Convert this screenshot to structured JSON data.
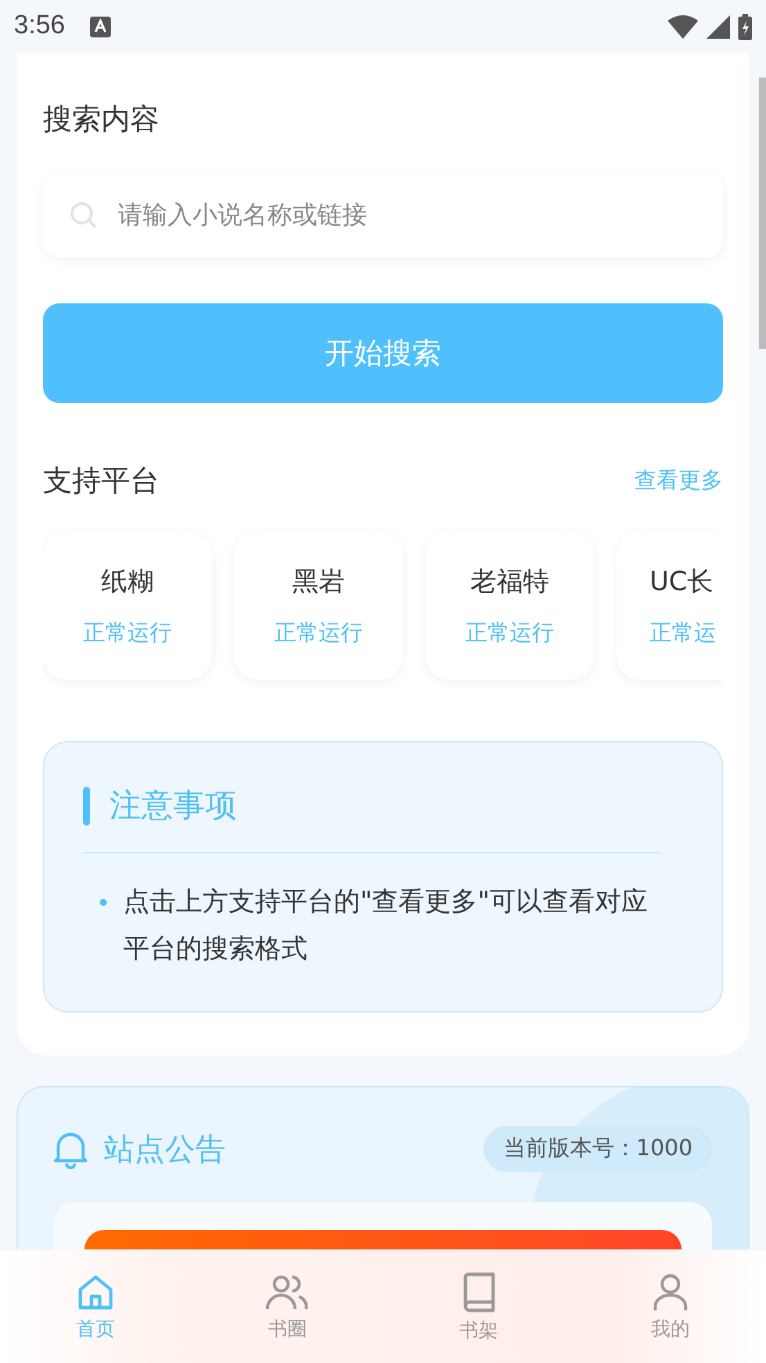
{
  "status_bar": {
    "time": "3:56"
  },
  "search": {
    "title": "搜索内容",
    "placeholder": "请输入小说名称或链接",
    "button": "开始搜索"
  },
  "platforms": {
    "title": "支持平台",
    "more": "查看更多",
    "items": [
      {
        "name": "纸糊",
        "status": "正常运行",
        "clipped": false
      },
      {
        "name": "黑岩",
        "status": "正常运行",
        "clipped": false
      },
      {
        "name": "老福特",
        "status": "正常运行",
        "clipped": false
      },
      {
        "name": "UC长",
        "status": "正常运",
        "clipped": true
      }
    ]
  },
  "notice": {
    "title": "注意事项",
    "items": [
      "点击上方支持平台的\"查看更多\"可以查看对应平台的搜索格式"
    ]
  },
  "announcement": {
    "title": "站点公告",
    "version": "当前版本号：1000"
  },
  "tabs": [
    {
      "label": "首页",
      "selected": true
    },
    {
      "label": "书圈",
      "selected": false
    },
    {
      "label": "书架",
      "selected": false
    },
    {
      "label": "我的",
      "selected": false
    }
  ]
}
